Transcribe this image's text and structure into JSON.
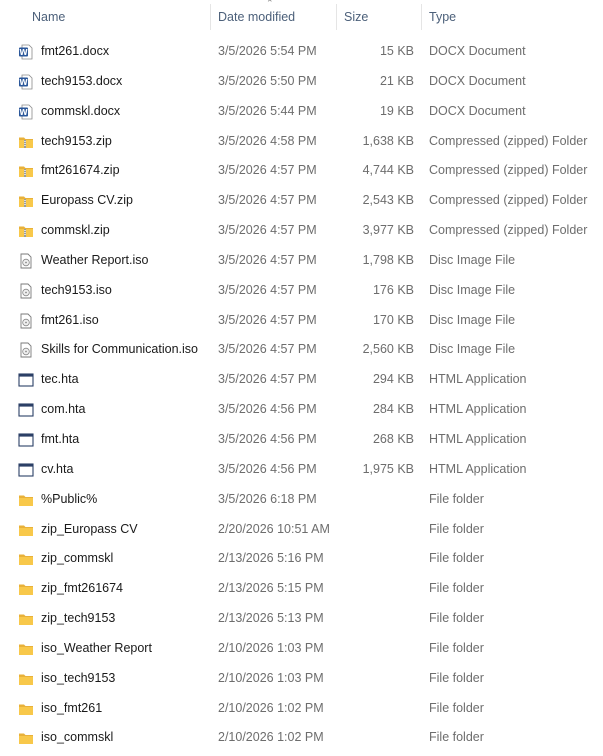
{
  "columns": {
    "name": "Name",
    "date": "Date modified",
    "size": "Size",
    "type": "Type"
  },
  "files": [
    {
      "name": "fmt261.docx",
      "date": "3/5/2026 5:54 PM",
      "size": "15 KB",
      "type": "DOCX Document",
      "icon": "word-doc-icon"
    },
    {
      "name": "tech9153.docx",
      "date": "3/5/2026 5:50 PM",
      "size": "21 KB",
      "type": "DOCX Document",
      "icon": "word-doc-icon"
    },
    {
      "name": "commskl.docx",
      "date": "3/5/2026 5:44 PM",
      "size": "19 KB",
      "type": "DOCX Document",
      "icon": "word-doc-icon"
    },
    {
      "name": "tech9153.zip",
      "date": "3/5/2026 4:58 PM",
      "size": "1,638 KB",
      "type": "Compressed (zipped) Folder",
      "icon": "zip-folder-icon"
    },
    {
      "name": "fmt261674.zip",
      "date": "3/5/2026 4:57 PM",
      "size": "4,744 KB",
      "type": "Compressed (zipped) Folder",
      "icon": "zip-folder-icon"
    },
    {
      "name": "Europass CV.zip",
      "date": "3/5/2026 4:57 PM",
      "size": "2,543 KB",
      "type": "Compressed (zipped) Folder",
      "icon": "zip-folder-icon"
    },
    {
      "name": "commskl.zip",
      "date": "3/5/2026 4:57 PM",
      "size": "3,977 KB",
      "type": "Compressed (zipped) Folder",
      "icon": "zip-folder-icon"
    },
    {
      "name": "Weather Report.iso",
      "date": "3/5/2026 4:57 PM",
      "size": "1,798 KB",
      "type": "Disc Image File",
      "icon": "disc-image-icon"
    },
    {
      "name": "tech9153.iso",
      "date": "3/5/2026 4:57 PM",
      "size": "176 KB",
      "type": "Disc Image File",
      "icon": "disc-image-icon"
    },
    {
      "name": "fmt261.iso",
      "date": "3/5/2026 4:57 PM",
      "size": "170 KB",
      "type": "Disc Image File",
      "icon": "disc-image-icon"
    },
    {
      "name": "Skills for Communication.iso",
      "date": "3/5/2026 4:57 PM",
      "size": "2,560 KB",
      "type": "Disc Image File",
      "icon": "disc-image-icon"
    },
    {
      "name": "tec.hta",
      "date": "3/5/2026 4:57 PM",
      "size": "294 KB",
      "type": "HTML Application",
      "icon": "hta-window-icon"
    },
    {
      "name": "com.hta",
      "date": "3/5/2026 4:56 PM",
      "size": "284 KB",
      "type": "HTML Application",
      "icon": "hta-window-icon"
    },
    {
      "name": "fmt.hta",
      "date": "3/5/2026 4:56 PM",
      "size": "268 KB",
      "type": "HTML Application",
      "icon": "hta-window-icon"
    },
    {
      "name": "cv.hta",
      "date": "3/5/2026 4:56 PM",
      "size": "1,975 KB",
      "type": "HTML Application",
      "icon": "hta-window-icon"
    },
    {
      "name": "%Public%",
      "date": "3/5/2026 6:18 PM",
      "size": "",
      "type": "File folder",
      "icon": "folder-icon"
    },
    {
      "name": "zip_Europass CV",
      "date": "2/20/2026 10:51 AM",
      "size": "",
      "type": "File folder",
      "icon": "folder-icon"
    },
    {
      "name": "zip_commskl",
      "date": "2/13/2026 5:16 PM",
      "size": "",
      "type": "File folder",
      "icon": "folder-icon"
    },
    {
      "name": "zip_fmt261674",
      "date": "2/13/2026 5:15 PM",
      "size": "",
      "type": "File folder",
      "icon": "folder-icon"
    },
    {
      "name": "zip_tech9153",
      "date": "2/13/2026 5:13 PM",
      "size": "",
      "type": "File folder",
      "icon": "folder-icon"
    },
    {
      "name": "iso_Weather Report",
      "date": "2/10/2026 1:03 PM",
      "size": "",
      "type": "File folder",
      "icon": "folder-icon"
    },
    {
      "name": "iso_tech9153",
      "date": "2/10/2026 1:03 PM",
      "size": "",
      "type": "File folder",
      "icon": "folder-icon"
    },
    {
      "name": "iso_fmt261",
      "date": "2/10/2026 1:02 PM",
      "size": "",
      "type": "File folder",
      "icon": "folder-icon"
    },
    {
      "name": "iso_commskl",
      "date": "2/10/2026 1:02 PM",
      "size": "",
      "type": "File folder",
      "icon": "folder-icon"
    }
  ],
  "colors": {
    "header_text": "#4c607a",
    "name_text": "#1a1a1a",
    "detail_text": "#6d6d6d",
    "folder_yellow": "#f8c84a",
    "word_blue": "#2b579a"
  }
}
